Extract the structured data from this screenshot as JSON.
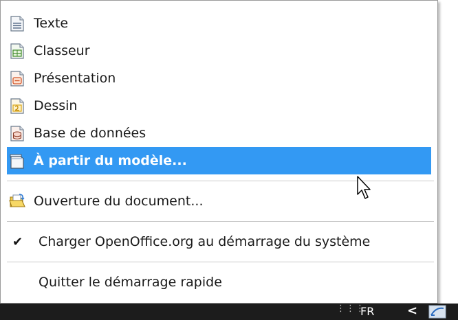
{
  "menu": {
    "items": [
      {
        "label": "Texte",
        "icon": "writer-document-icon"
      },
      {
        "label": "Classeur",
        "icon": "calc-spreadsheet-icon"
      },
      {
        "label": "Présentation",
        "icon": "impress-presentation-icon"
      },
      {
        "label": "Dessin",
        "icon": "draw-drawing-icon"
      },
      {
        "label": "Base de données",
        "icon": "base-database-icon"
      },
      {
        "label": "À partir du modèle...",
        "icon": "template-icon"
      }
    ],
    "open_document": {
      "label": "Ouverture du document...",
      "icon": "folder-open-icon"
    },
    "load_on_startup": {
      "label": "Charger OpenOffice.org au démarrage du système",
      "checked": true
    },
    "quit": {
      "label": "Quitter le démarrage rapide"
    }
  },
  "taskbar": {
    "language": "FR",
    "chevron": "<",
    "dots": "⋮⋮⋮"
  },
  "colors": {
    "highlight": "#3399f3",
    "taskbar": "#1c1c1c"
  }
}
